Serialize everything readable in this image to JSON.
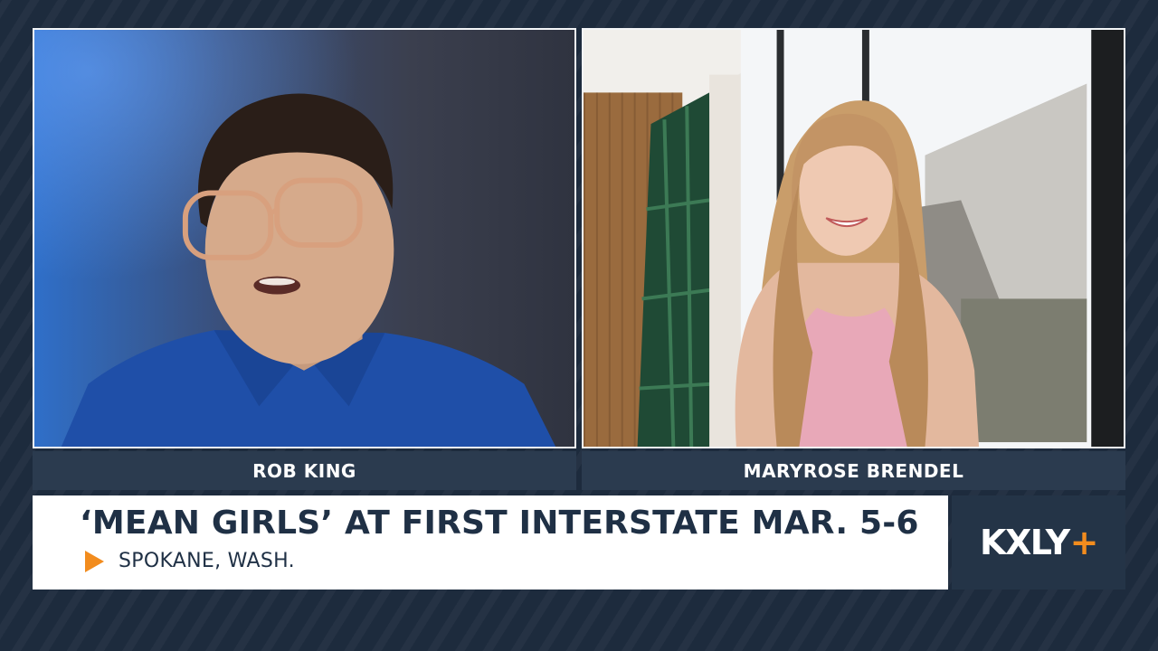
{
  "guests": {
    "left": {
      "name": "ROB KING"
    },
    "right": {
      "name": "MARYROSE BRENDEL"
    }
  },
  "lower_third": {
    "headline": "‘MEAN GIRLS’ AT FIRST INTERSTATE MAR. 5-6",
    "location": "SPOKANE, WASH."
  },
  "station": {
    "logo_text": "KXLY",
    "logo_plus": "+"
  },
  "colors": {
    "background": "#1d2b3d",
    "nameplate": "#2b3b4f",
    "headline_text": "#1f3045",
    "accent": "#f28c1e",
    "logo_box": "#243447"
  },
  "icons": {
    "location_marker": "play-triangle-icon"
  }
}
